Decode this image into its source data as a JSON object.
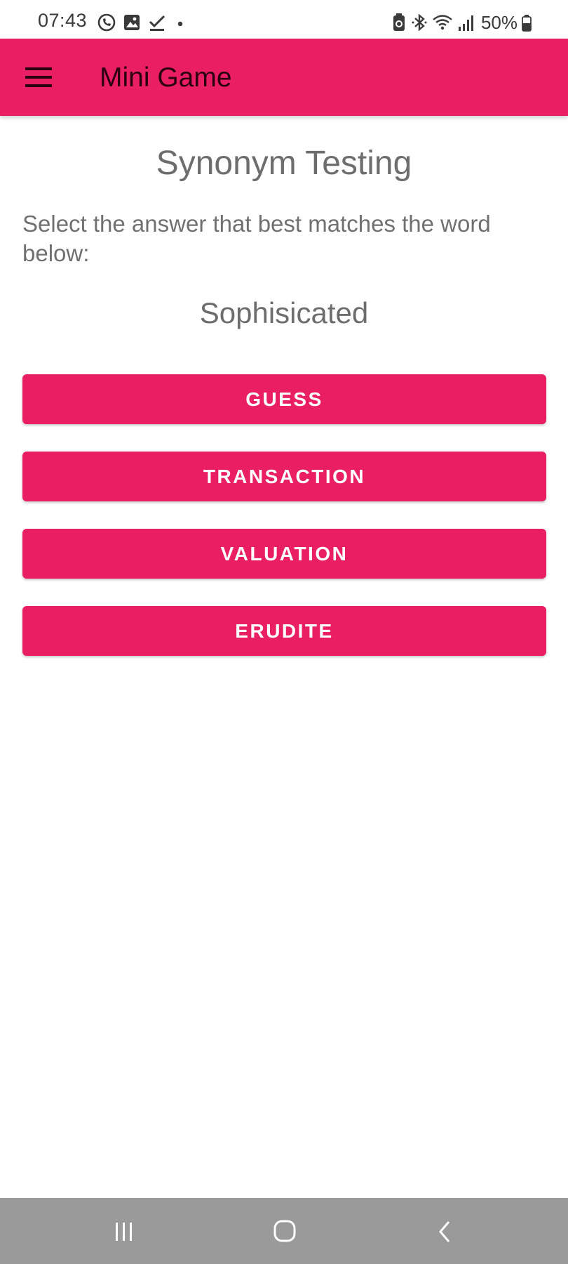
{
  "status_bar": {
    "time": "07:43",
    "battery": "50%",
    "left_icons": [
      "viber-icon",
      "gallery-icon",
      "download-done-icon",
      "dot-icon"
    ],
    "right_icons": [
      "battery-saver-icon",
      "bluetooth-icon",
      "wifi-icon",
      "signal-icon",
      "battery-icon"
    ]
  },
  "app_bar": {
    "title": "Mini Game",
    "menu_icon": "hamburger-menu-icon"
  },
  "main": {
    "title": "Synonym Testing",
    "instruction": "Select the answer that best matches the word below:",
    "word": "Sophisicated",
    "answers": [
      "GUESS",
      "TRANSACTION",
      "VALUATION",
      "ERUDITE"
    ]
  },
  "nav_bar": {
    "icons": [
      "recents-icon",
      "home-icon",
      "back-icon"
    ]
  },
  "colors": {
    "accent": "#e91e63",
    "app_title": "#2b0010",
    "text_gray": "#6d6d6d",
    "nav_bar": "#9a9a9a"
  }
}
